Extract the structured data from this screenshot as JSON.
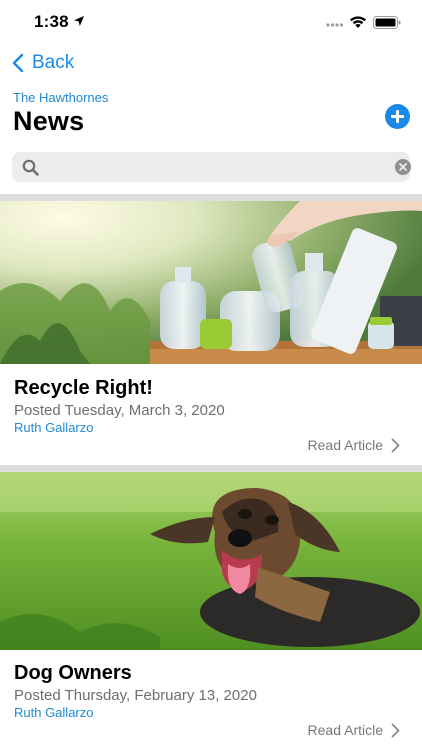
{
  "status_bar": {
    "time": "1:38"
  },
  "nav": {
    "back_label": "Back"
  },
  "header": {
    "community": "The Hawthornes",
    "title": "News"
  },
  "search": {
    "placeholder": "",
    "value": ""
  },
  "articles": [
    {
      "title": "Recycle Right!",
      "date": "Posted Tuesday, March 3, 2020",
      "author": "Ruth Gallarzo",
      "read_label": "Read Article",
      "image": "recycling-bottles-photo"
    },
    {
      "title": "Dog Owners",
      "date": "Posted Thursday, February 13, 2020",
      "author": "Ruth Gallarzo",
      "read_label": "Read Article",
      "image": "dog-on-grass-photo"
    }
  ],
  "colors": {
    "accent": "#1a8ae6",
    "link": "#1f8ad4",
    "divider": "#dedede"
  }
}
